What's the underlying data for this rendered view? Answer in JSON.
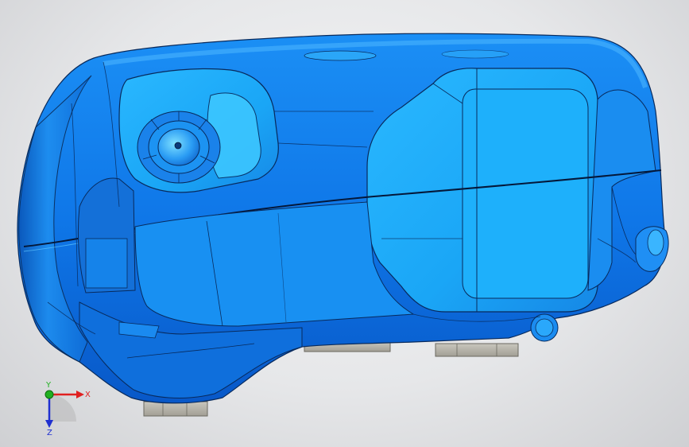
{
  "viewport": {
    "background": "#e6e7e9",
    "model_color": "#1f8bff",
    "model_highlight": "#39c4ff",
    "edge_color": "#0a2a55",
    "support_color": "#b4b2a8"
  },
  "triad": {
    "x_label": "X",
    "y_label": "Y",
    "z_label": "Z",
    "x_color": "#e02020",
    "y_color": "#20b020",
    "z_color": "#2030d0"
  }
}
